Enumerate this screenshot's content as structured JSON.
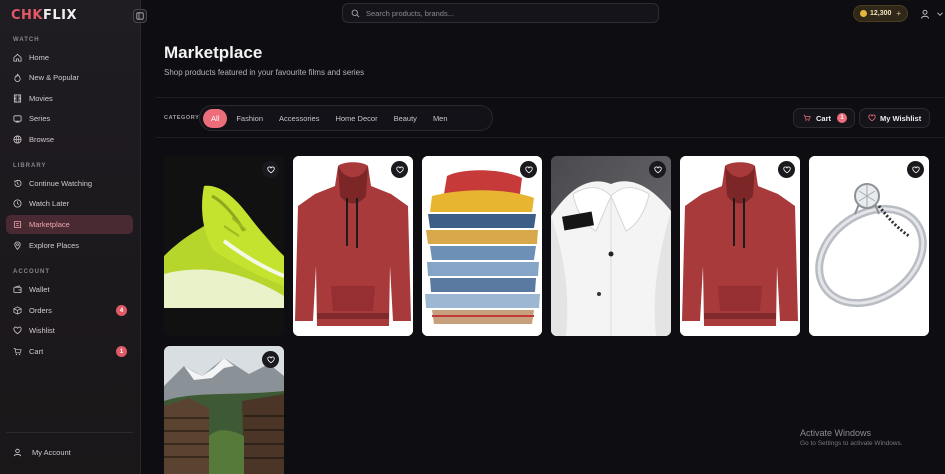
{
  "brand": {
    "logo_part1": "CHK",
    "logo_part2": "FLIX"
  },
  "sidebar": {
    "watch_label": "WATCH",
    "watch_items": [
      {
        "label": "Home",
        "icon": "home-icon"
      },
      {
        "label": "New & Popular",
        "icon": "flame-icon"
      },
      {
        "label": "Movies",
        "icon": "film-icon"
      },
      {
        "label": "Series",
        "icon": "tv-icon"
      },
      {
        "label": "Browse",
        "icon": "globe-icon"
      }
    ],
    "library_label": "LIBRARY",
    "library_items": [
      {
        "label": "Continue Watching",
        "icon": "history-icon"
      },
      {
        "label": "Watch Later",
        "icon": "clock-icon"
      },
      {
        "label": "Marketplace",
        "icon": "store-icon",
        "active": true
      },
      {
        "label": "Explore Places",
        "icon": "map-pin-icon"
      }
    ],
    "account_label": "ACCOUNT",
    "account_items": [
      {
        "label": "Wallet",
        "icon": "wallet-icon"
      },
      {
        "label": "Orders",
        "icon": "box-icon",
        "badge": "4"
      },
      {
        "label": "Wishlist",
        "icon": "heart-icon"
      },
      {
        "label": "Cart",
        "icon": "cart-icon",
        "badge": "1"
      }
    ],
    "my_account": "My Account"
  },
  "topbar": {
    "search_placeholder": "Search products, brands...",
    "coins": "12,300",
    "coins_plus": "+"
  },
  "main": {
    "title": "Marketplace",
    "subtitle": "Shop products featured in your favourite films and series",
    "category_label": "CATEGORY",
    "categories": [
      "All",
      "Fashion",
      "Accessories",
      "Home Decor",
      "Beauty",
      "Men"
    ],
    "active_category": "All",
    "cart_label": "Cart",
    "cart_count": "1",
    "wishlist_label": "My Wishlist"
  },
  "products": [
    {
      "image": "green sneakers"
    },
    {
      "image": "red hoodie"
    },
    {
      "image": "stack of folded clothes"
    },
    {
      "image": "white shirt"
    },
    {
      "image": "red hoodie"
    },
    {
      "image": "silver diamond ring"
    },
    {
      "image": "mountain village"
    }
  ],
  "watermark": {
    "line1": "Activate Windows",
    "line2": "Go to Settings to activate Windows."
  },
  "colors": {
    "accent": "#ec6e7b",
    "background": "#0e0d12",
    "sidebar": "#1f1c22"
  }
}
